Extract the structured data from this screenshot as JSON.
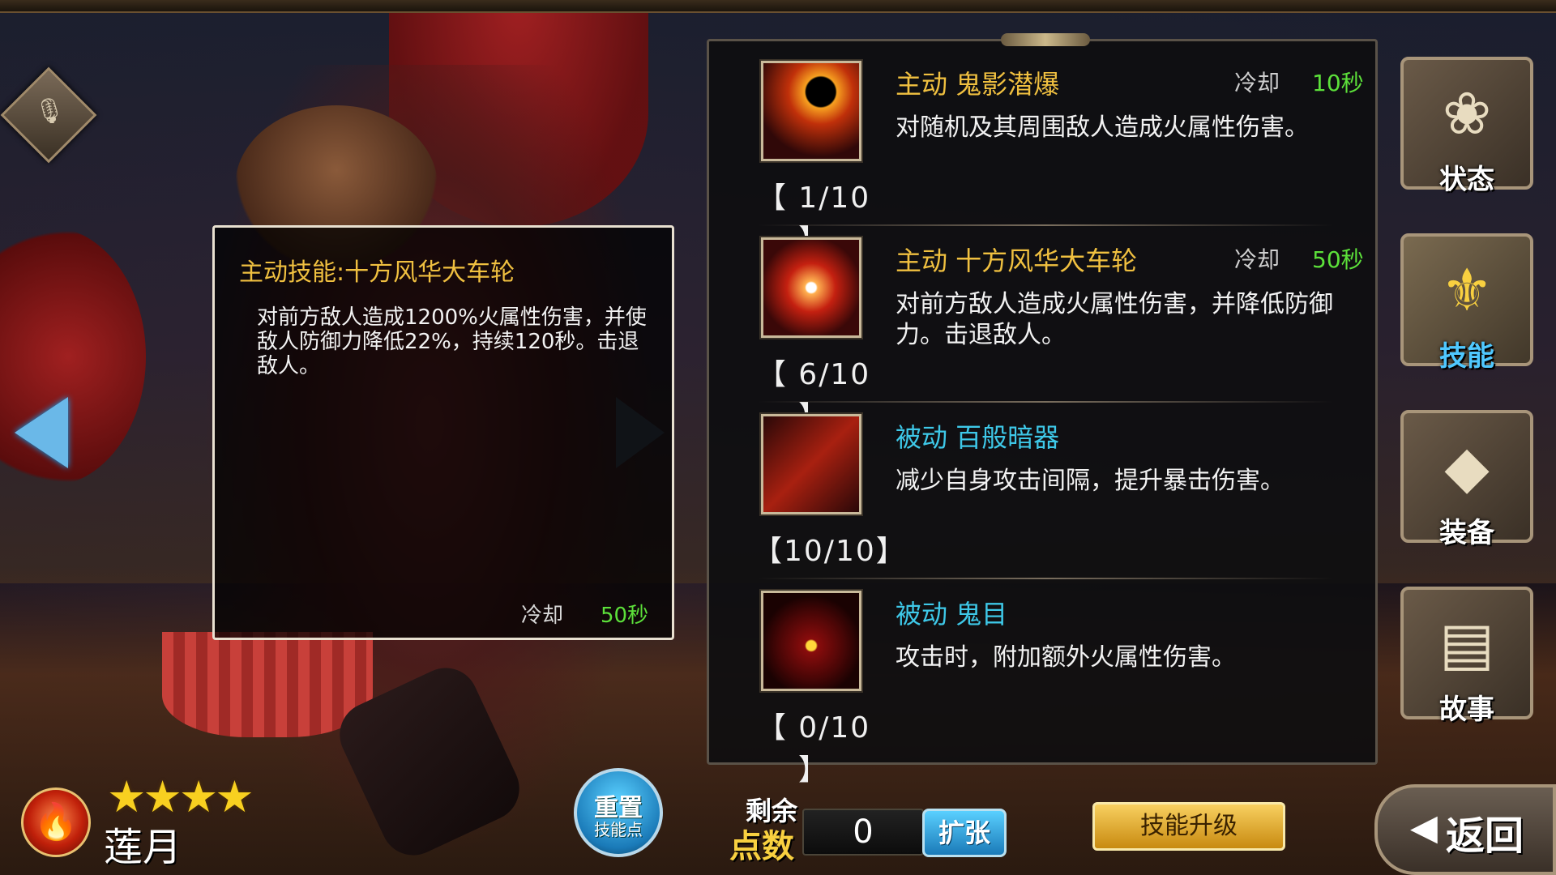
{
  "tooltip": {
    "title": "主动技能:十方风华大车轮",
    "description": "对前方敌人造成1200%火属性伤害，并使敌人防御力降低22%，持续120秒。击退敌人。",
    "cooldown_label": "冷却",
    "cooldown_value": "50秒"
  },
  "skills": [
    {
      "name": "主动 鬼影潜爆",
      "kind": "active",
      "cooldown_label": "冷却",
      "cooldown_value": "10秒",
      "description": "对随机及其周围敌人造成火属性伤害。",
      "level": "【 1/10 】",
      "icon": "meteor-icon"
    },
    {
      "name": "主动 十方风华大车轮",
      "kind": "active",
      "cooldown_label": "冷却",
      "cooldown_value": "50秒",
      "description": "对前方敌人造成火属性伤害，并降低防御力。击退敌人。",
      "level": "【 6/10 】",
      "icon": "shuriken-icon"
    },
    {
      "name": "被动 百般暗器",
      "kind": "passive",
      "description": "减少自身攻击间隔，提升暴击伤害。",
      "level": "【10/10】",
      "icon": "kunai-icon"
    },
    {
      "name": "被动 鬼目",
      "kind": "passive",
      "description": "攻击时，附加额外火属性伤害。",
      "level": "【 0/10 】",
      "icon": "demon-mask-icon"
    }
  ],
  "side_menu": [
    {
      "label": "状态",
      "icon": "rose-icon",
      "selected": false
    },
    {
      "label": "技能",
      "icon": "fleur-crest-icon",
      "selected": true
    },
    {
      "label": "装备",
      "icon": "crystal-icon",
      "selected": false
    },
    {
      "label": "故事",
      "icon": "book-icon",
      "selected": false
    }
  ],
  "character": {
    "name": "莲月",
    "stars": 4,
    "stars_display": "★★★★",
    "element_icon": "fire-icon"
  },
  "bottom": {
    "reset_line1": "重置",
    "reset_line2": "技能点",
    "remaining_line1": "剩余",
    "remaining_line2": "点数",
    "points_value": "0",
    "expand_label": "扩张",
    "upgrade_label": "技能升级",
    "back_label": "返回"
  },
  "colors": {
    "active_skill": "#f0c040",
    "passive_skill": "#3ec8e8",
    "cooldown_value": "#5ce03a",
    "selected_tab": "#4fc8ff"
  }
}
